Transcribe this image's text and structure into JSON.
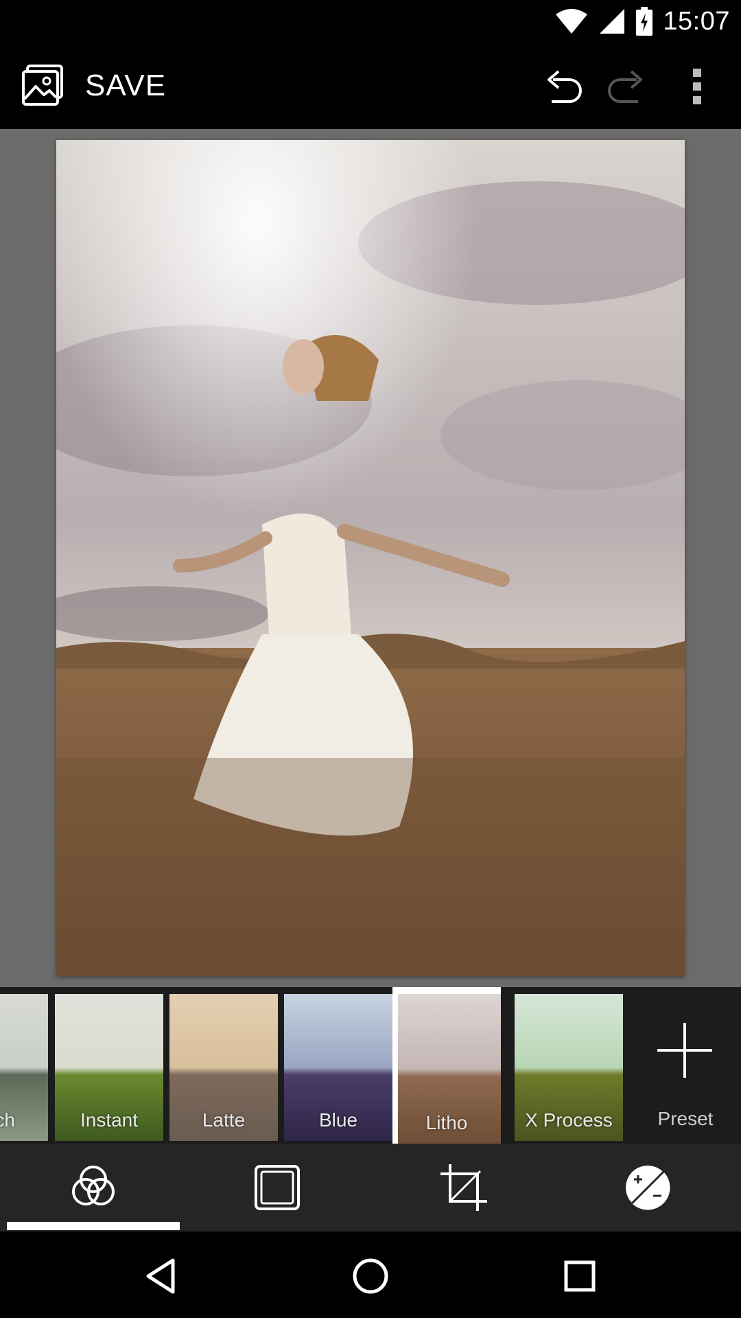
{
  "status_bar": {
    "time": "15:07"
  },
  "toolbar": {
    "save_label": "SAVE"
  },
  "filters": [
    {
      "label": "Bleach",
      "visible_label": "ach",
      "tint": "#8a9a86"
    },
    {
      "label": "Instant",
      "tint": "#5e7a2a"
    },
    {
      "label": "Latte",
      "tint": "#b79a72"
    },
    {
      "label": "Blue",
      "tint": "#4a4a78"
    },
    {
      "label": "Litho",
      "tint": "#9c7a66",
      "selected": true
    },
    {
      "label": "X Process",
      "tint": "#7a8a3a"
    }
  ],
  "preset": {
    "label": "Preset"
  },
  "bottom_tools": {
    "items": [
      "filters",
      "frames",
      "crop",
      "adjust"
    ],
    "active": "filters"
  },
  "colors": {
    "background": "#000000",
    "canvas": "#6b6b6b",
    "strip": "#1c1c1c",
    "tools_bar": "#252525",
    "accent": "#ffffff"
  }
}
